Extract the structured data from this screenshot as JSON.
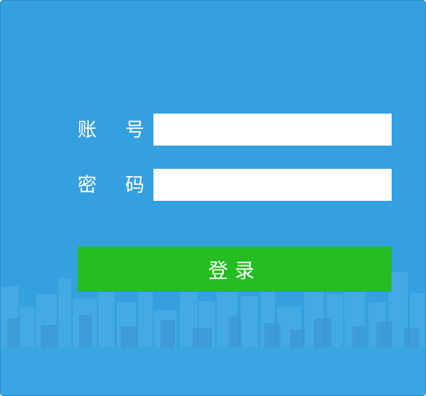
{
  "login_form": {
    "account_label": "账 号",
    "account_value": "",
    "password_label": "密 码",
    "password_value": "",
    "submit_label": "登录"
  },
  "colors": {
    "background": "#35a0df",
    "button": "#24bd22",
    "text": "#ffffff"
  }
}
